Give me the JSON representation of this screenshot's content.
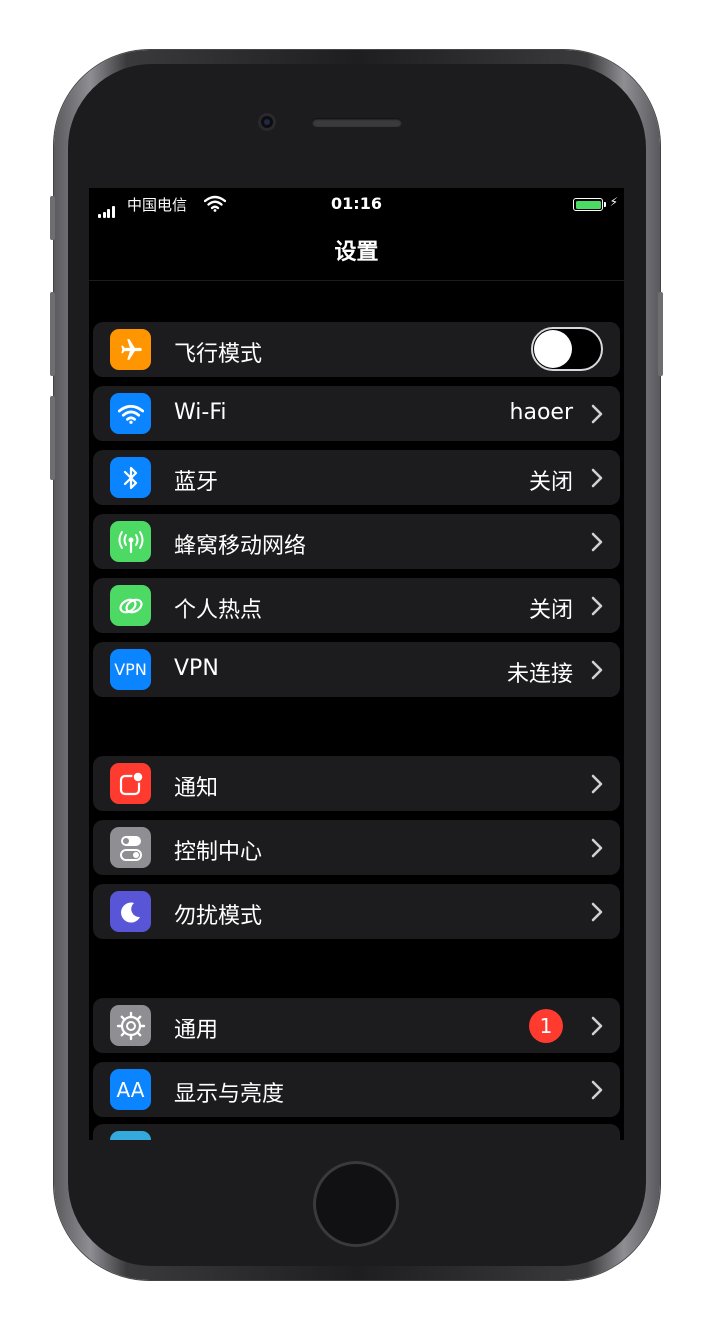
{
  "status_bar": {
    "carrier": "中国电信",
    "time": "01:16",
    "battery_level": 1.0
  },
  "nav": {
    "title": "设置"
  },
  "groups": [
    {
      "rows": [
        {
          "label": "飞行模式",
          "icon": "airplane-icon",
          "color": "#ff9500",
          "control": "toggle",
          "toggle_on": false
        },
        {
          "label": "Wi-Fi",
          "icon": "wifi-icon",
          "color": "#0a84ff",
          "value": "haoer"
        },
        {
          "label": "蓝牙",
          "icon": "bluetooth-icon",
          "color": "#0a84ff",
          "value": "关闭"
        },
        {
          "label": "蜂窝移动网络",
          "icon": "cellular-antenna-icon",
          "color": "#4cd964",
          "value": ""
        },
        {
          "label": "个人热点",
          "icon": "hotspot-chain-icon",
          "color": "#4cd964",
          "value": "关闭"
        },
        {
          "label": "VPN",
          "icon": "vpn-icon",
          "icon_text": "VPN",
          "color": "#0a84ff",
          "value": "未连接"
        }
      ]
    },
    {
      "rows": [
        {
          "label": "通知",
          "icon": "notifications-icon",
          "color": "#ff3b30",
          "value": ""
        },
        {
          "label": "控制中心",
          "icon": "control-center-icon",
          "color": "#8e8e93",
          "value": ""
        },
        {
          "label": "勿扰模式",
          "icon": "moon-icon",
          "color": "#5856d6",
          "value": ""
        }
      ]
    },
    {
      "rows": [
        {
          "label": "通用",
          "icon": "gear-icon",
          "color": "#8e8e93",
          "badge": "1",
          "value": ""
        },
        {
          "label": "显示与亮度",
          "icon": "text-size-icon",
          "icon_text": "AA",
          "color": "#0a84ff",
          "value": ""
        }
      ]
    }
  ]
}
